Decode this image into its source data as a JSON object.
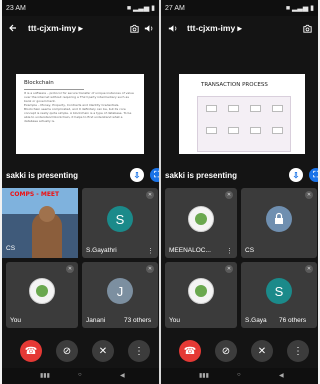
{
  "left": {
    "status": {
      "time": "23 AM",
      "right": "■ ▂▃▅ ▮"
    },
    "header": {
      "title": "ttt-cjxm-imy ▸"
    },
    "slide": {
      "title": "Blockchain",
      "bullets": [
        "It is a software – protocol for secure transfer of unique instances of value over the internet without requiring a Third party intermediary such as bank or government.",
        "Example – Money, Property, Contracts and Identity Credentials.",
        "Blockchain seems complicated, and it definitely can be, but its core concept is really quite simple. A blockchain is a type of database. To be able to understand blockchain, it helps to first understand what a database actually is."
      ]
    },
    "presenting": "sakki is presenting",
    "camera": {
      "banner": "COMPS - MEET",
      "name": "CS"
    },
    "tiles": [
      {
        "avatar": "S",
        "name": "S.Gayathri",
        "color": "#1b8a8a"
      },
      {
        "name": "You"
      },
      {
        "avatar": "J",
        "name": "Janani",
        "others": "73 others",
        "color": "#7c8fa0"
      }
    ]
  },
  "right": {
    "status": {
      "time": "27 AM",
      "right": "■ ▂▃▅ ▮"
    },
    "header": {
      "title": "ttt-cjxm-imy ▸"
    },
    "slide": {
      "title": "TRANSACTION PROCESS"
    },
    "presenting": "sakki is presenting",
    "tiles": [
      {
        "name": "MEENALOC..."
      },
      {
        "name": "CS"
      },
      {
        "name": "You"
      },
      {
        "avatar": "S",
        "name": "S.Gaya",
        "others": "76 others",
        "color": "#1b8a8a"
      }
    ]
  },
  "colors": {
    "end_call": "#e53935",
    "control_bg": "#3c3c3c"
  },
  "icons": {
    "back": "arrow-left-icon",
    "camera_switch": "camera-switch-icon",
    "speaker": "speaker-icon",
    "mic_off": "mic-off-icon",
    "cam_off": "camera-off-icon",
    "more": "more-vert-icon"
  }
}
